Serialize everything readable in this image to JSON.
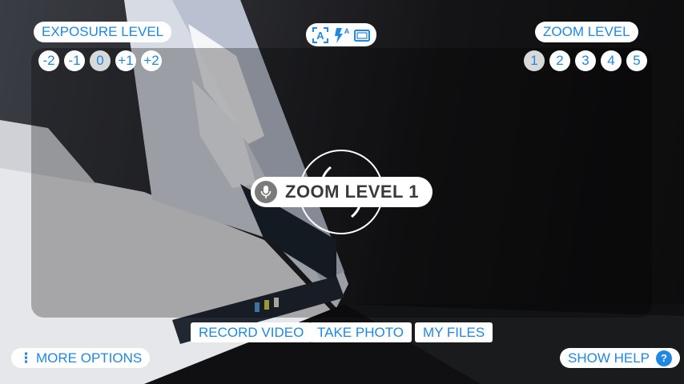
{
  "exposure": {
    "label": "EXPOSURE LEVEL",
    "levels": [
      "-2",
      "-1",
      "0",
      "+1",
      "+2"
    ],
    "selected": "0"
  },
  "camera_modes": {
    "icons": [
      "auto-focus-icon",
      "flash-auto-icon",
      "aspect-ratio-icon"
    ],
    "flash_auto_badge": "A",
    "auto_focus_badge": "A"
  },
  "zoom": {
    "label": "ZOOM LEVEL",
    "levels": [
      "1",
      "2",
      "3",
      "4",
      "5"
    ],
    "selected": "1"
  },
  "toast": {
    "text": "ZOOM LEVEL 1",
    "icon": "microphone-icon"
  },
  "bottom_bar": {
    "record_video": "RECORD VIDEO",
    "take_photo": "TAKE PHOTO",
    "my_files": "MY FILES"
  },
  "more_options": {
    "label": "MORE OPTIONS",
    "icon": "vertical-dots-icon"
  },
  "show_help": {
    "label": "SHOW HELP",
    "badge": "?"
  },
  "colors": {
    "accent": "#1e88e5",
    "pill_bg": "#ffffff",
    "selected_bg": "#d9d9d9"
  }
}
